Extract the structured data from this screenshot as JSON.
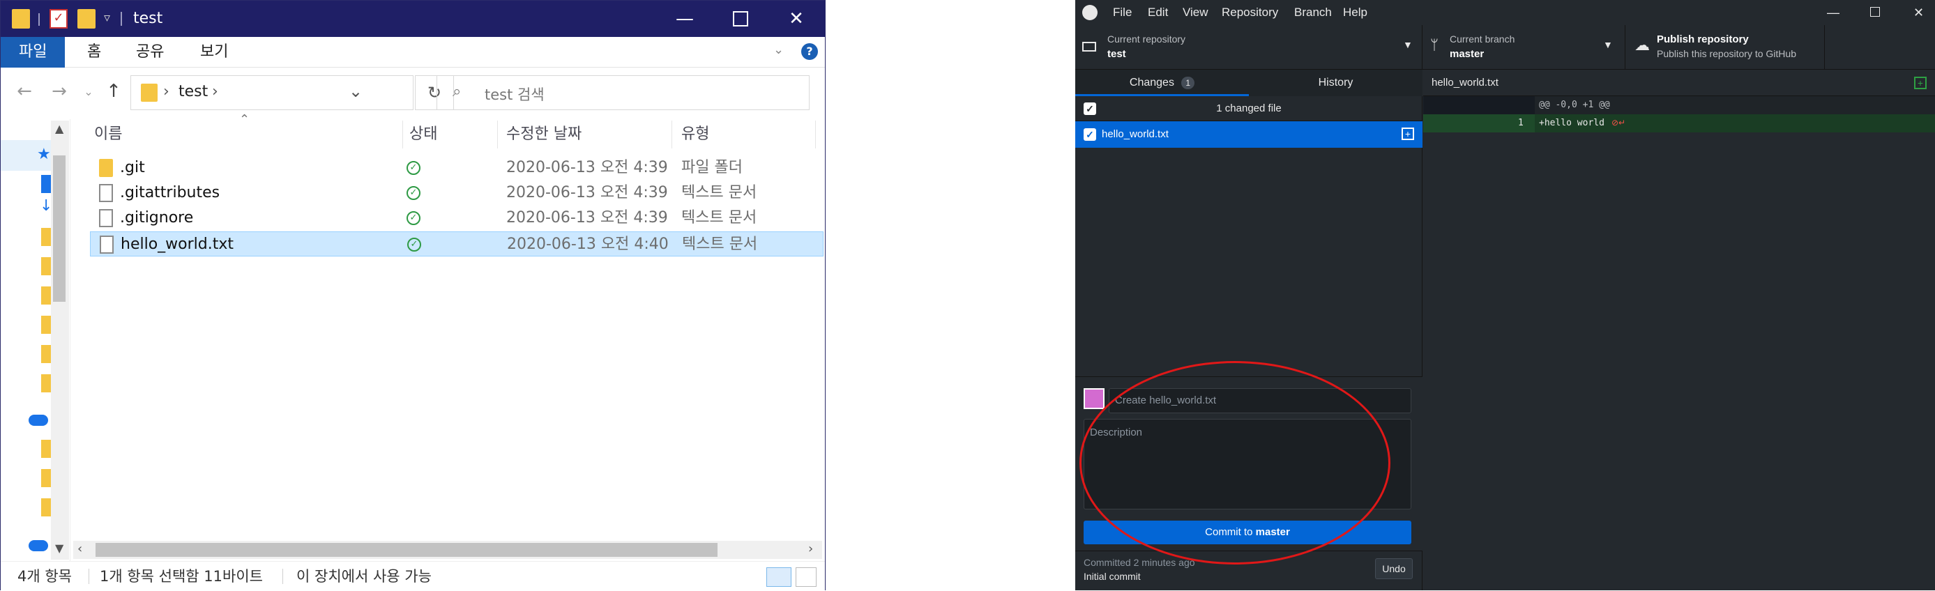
{
  "explorer": {
    "title": "test",
    "ribbon_tabs": [
      "파일",
      "홈",
      "공유",
      "보기"
    ],
    "breadcrumb": "test",
    "search_placeholder": "test 검색",
    "columns": [
      "이름",
      "상태",
      "수정한 날짜",
      "유형"
    ],
    "files": [
      {
        "name": ".git",
        "date": "2020-06-13 오전 4:39",
        "type": "파일 폴더",
        "icon": "folder-icon"
      },
      {
        "name": ".gitattributes",
        "date": "2020-06-13 오전 4:39",
        "type": "텍스트 문서",
        "icon": "document-icon"
      },
      {
        "name": ".gitignore",
        "date": "2020-06-13 오전 4:39",
        "type": "텍스트 문서",
        "icon": "document-icon"
      },
      {
        "name": "hello_world.txt",
        "date": "2020-06-13 오전 4:40",
        "type": "텍스트 문서",
        "icon": "document-icon"
      }
    ],
    "status": {
      "count": "4개 항목",
      "selection": "1개 항목 선택함 11바이트",
      "availability": "이 장치에서 사용 가능"
    }
  },
  "github_desktop": {
    "menu": [
      "File",
      "Edit",
      "View",
      "Repository",
      "Branch",
      "Help"
    ],
    "repo": {
      "label": "Current repository",
      "name": "test"
    },
    "branch": {
      "label": "Current branch",
      "name": "master"
    },
    "publish": {
      "title": "Publish repository",
      "subtitle": "Publish this repository to GitHub"
    },
    "tabs": {
      "changes": "Changes",
      "changes_count": "1",
      "history": "History"
    },
    "changed_header": "1 changed file",
    "changed_file": "hello_world.txt",
    "summary_placeholder": "Create hello_world.txt",
    "description_placeholder": "Description",
    "commit_prefix": "Commit to",
    "commit_branch": "master",
    "footer": {
      "committed": "Committed 2 minutes ago",
      "message": "Initial commit",
      "undo": "Undo"
    },
    "diff": {
      "file": "hello_world.txt",
      "hunk": "@@ -0,0 +1 @@",
      "line_number": "1",
      "added_line": "+hello world"
    }
  },
  "colors": {
    "explorer_titlebar": "#1f1f66",
    "gh_background": "#24292e",
    "gh_accent": "#0366d6",
    "annotation": "#e01818"
  }
}
